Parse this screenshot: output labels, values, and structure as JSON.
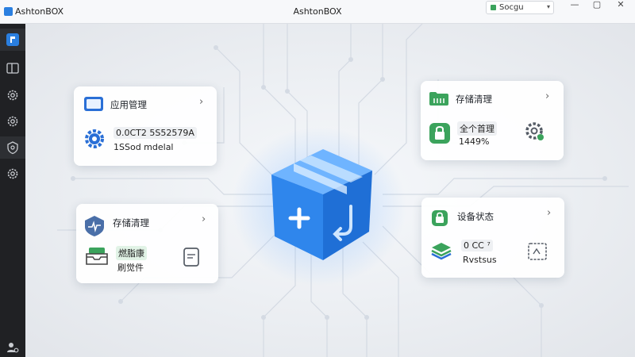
{
  "window": {
    "app_name": "AshtonBOX",
    "title": "AshtonBOX"
  },
  "search": {
    "label": "Socgu"
  },
  "sidebar": {
    "items": [
      "logo",
      "browser",
      "settings",
      "settings-2",
      "shield",
      "settings-3"
    ]
  },
  "cards": {
    "app_manager": {
      "title": "应用管理",
      "line1": "0.0CT2 5S52579A",
      "line2": "1SSod mdelal"
    },
    "storage_right": {
      "title": "存储清理",
      "line1": "全个首理",
      "line2": "1449%"
    },
    "storage_left": {
      "title": "存储清理",
      "tag": "燃脂康",
      "line2": "刷觉件"
    },
    "device_status": {
      "title": "设备状态",
      "line1": "0 CC ⁷",
      "line2": "Rvstsus"
    }
  },
  "colors": {
    "accent": "#2a7fe0",
    "green": "#3ba35c",
    "sidebar": "#202124"
  }
}
